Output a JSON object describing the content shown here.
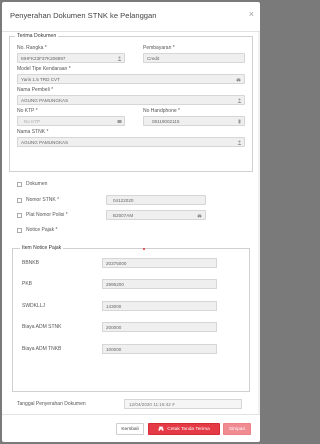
{
  "modal": {
    "title": "Penyerahan Dokumen STNK ke Pelanggan",
    "close": "×"
  },
  "terima": {
    "legend": "Terima Dokumen",
    "no_rangka": {
      "label": "No. Rangka *",
      "value": "MHFK23F37K206897"
    },
    "pembayaran": {
      "label": "Pembayaran *",
      "value": "Credit"
    },
    "model": {
      "label": "Model Tipe Kendaraan *",
      "value": "Yaris 1.5 TRD CVT"
    },
    "nama_pembeli": {
      "label": "Nama Pembeli *",
      "value": "AGUNG PAMUNGKAS"
    },
    "no_ktp": {
      "label": "No KTP *",
      "placeholder": "No KTP"
    },
    "no_hp": {
      "label": "No Handphone *",
      "value": "08119002115"
    },
    "nama_stnk": {
      "label": "Nama STNK *",
      "value": "AGUNG PAMUNGKAS"
    }
  },
  "dokumen": {
    "label": "Dokumen",
    "nomor_stnk": {
      "label": "Nomor STNK *",
      "value": "04122020"
    },
    "plat": {
      "label": "Plat Nomor Polisi *",
      "value": "B2007AM"
    },
    "notice": {
      "label": "Notice Pajak *"
    }
  },
  "notice_items": {
    "legend": "Item Notice Pajak",
    "rows": [
      {
        "label": "BBNKB",
        "value": "20375000"
      },
      {
        "label": "PKB",
        "value": "2995200"
      },
      {
        "label": "SWDKLLJ",
        "value": "143000"
      },
      {
        "label": "Biaya ADM STNK",
        "value": "200000"
      },
      {
        "label": "Biaya ADM TNKB",
        "value": "100000"
      }
    ]
  },
  "tanggal": {
    "label": "Tanggal Penyerahan Dokumen",
    "value": "12/04/2020 11:15:42 #"
  },
  "footer": {
    "back": "Kembali",
    "print": "Cetak Tanda Terima",
    "save": "Simpan"
  },
  "colors": {
    "primary": "#e43a45",
    "primary_disabled": "#f08b91"
  }
}
